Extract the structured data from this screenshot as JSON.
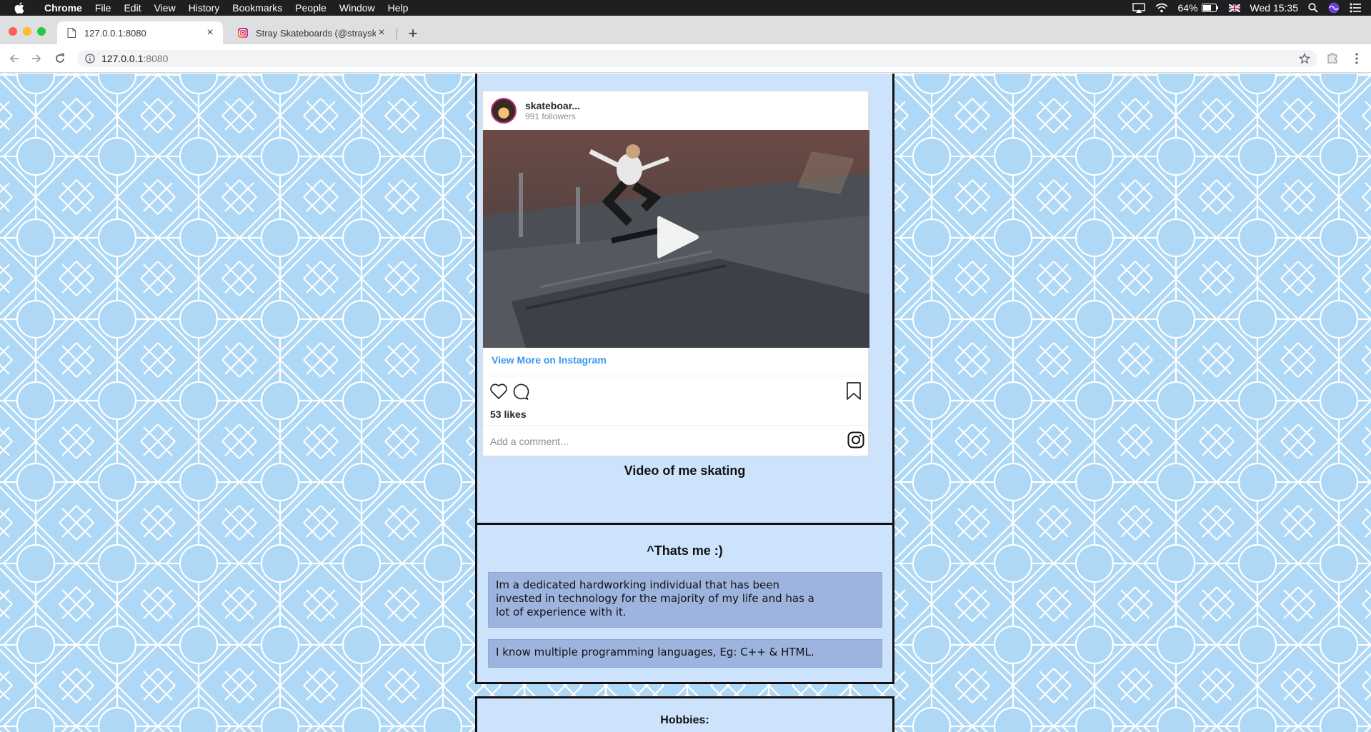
{
  "menubar": {
    "app_name": "Chrome",
    "menus": [
      "File",
      "Edit",
      "View",
      "History",
      "Bookmarks",
      "People",
      "Window",
      "Help"
    ],
    "battery": "64%",
    "clock": "Wed 15:35"
  },
  "tabs": [
    {
      "title": "127.0.0.1:8080",
      "active": true
    },
    {
      "title": "Stray Skateboards (@strayskat",
      "active": false
    }
  ],
  "address_bar": {
    "host": "127.0.0.1",
    "port": ":8080"
  },
  "instagram_embed": {
    "username": "skateboar...",
    "followers": "991 followers",
    "view_more": "View More on Instagram",
    "likes": "53 likes",
    "comment_placeholder": "Add a comment..."
  },
  "video_card": {
    "caption": "Video of me skating"
  },
  "about_card": {
    "title": "^Thats me :)",
    "paragraphs": [
      "Im a dedicated hardworking individual that has been invested in technology for the majority of my life and has a lot of experience with it.",
      "I know multiple programming languages, Eg: C++ & HTML."
    ]
  },
  "hobbies_card": {
    "title": "Hobbies:"
  },
  "colors": {
    "page_background": "#aed8f5",
    "card_background": "#cde2fb",
    "info_box": "#9db4df",
    "instagram_link": "#3897f0"
  },
  "icons": [
    "apple-icon",
    "airplay-icon",
    "wifi-icon",
    "battery-icon",
    "flag-icon",
    "spotlight-icon",
    "siri-icon",
    "control-center-icon",
    "page-icon",
    "instagram-favicon",
    "back-icon",
    "forward-icon",
    "reload-icon",
    "info-icon",
    "star-icon",
    "extension-icon",
    "menu-icon",
    "play-icon",
    "heart-icon",
    "comment-icon",
    "bookmark-icon",
    "instagram-icon"
  ]
}
